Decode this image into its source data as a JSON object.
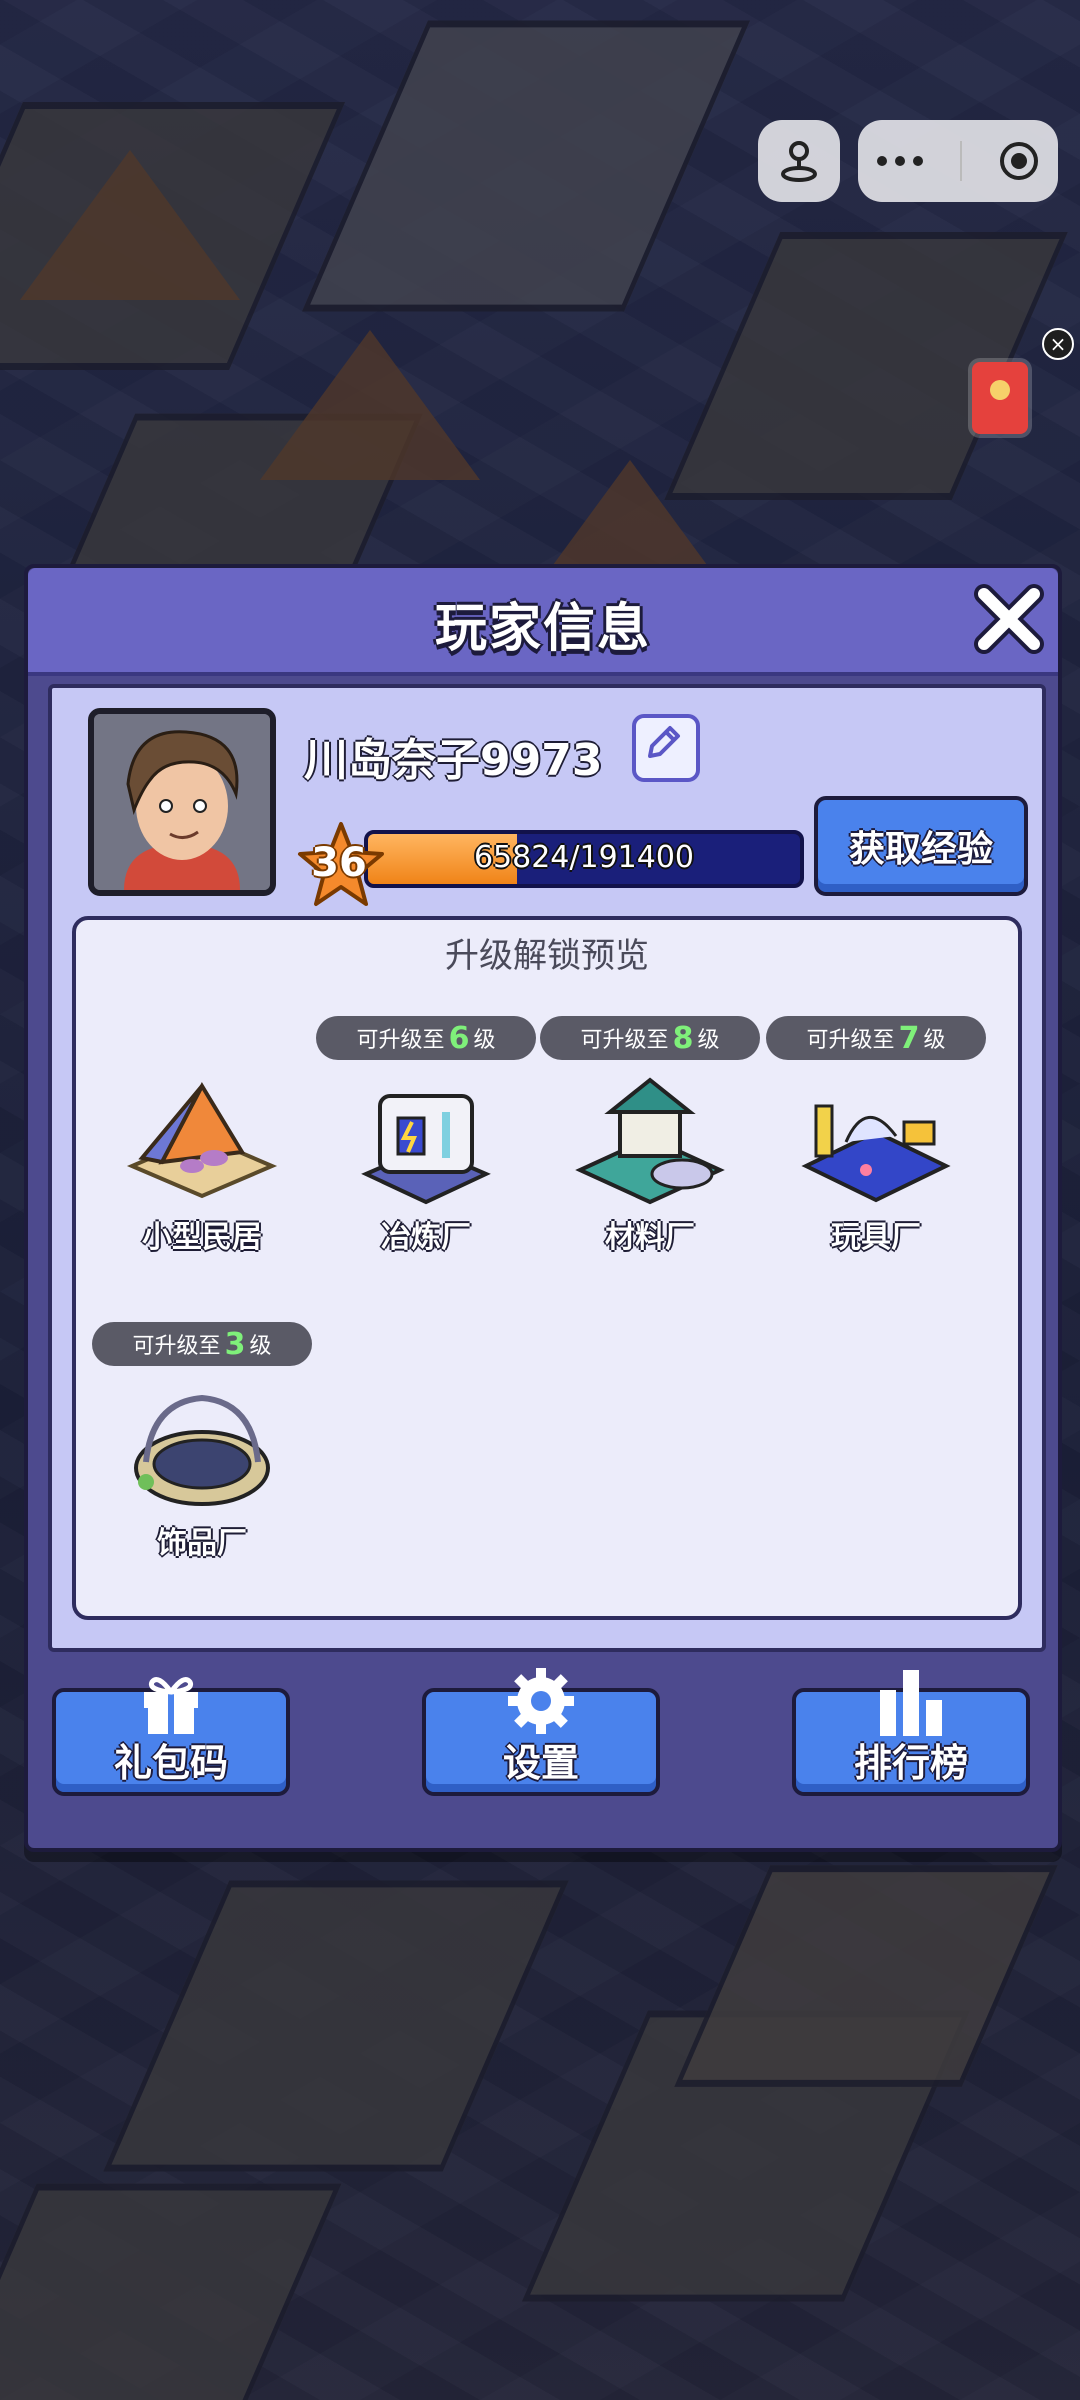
{
  "dialog": {
    "title": "玩家信息"
  },
  "player": {
    "name": "川岛奈子9973",
    "level": "36",
    "exp_current": 65824,
    "exp_max": 191400,
    "exp_text": "65824/191400",
    "get_exp_label": "获取经验"
  },
  "preview": {
    "title": "升级解锁预览",
    "buildings": [
      {
        "name": "小型民居",
        "pill_prefix": "",
        "pill_level": "",
        "pill_suffix": ""
      },
      {
        "name": "冶炼厂",
        "pill_prefix": "可升级至",
        "pill_level": "6",
        "pill_suffix": "级"
      },
      {
        "name": "材料厂",
        "pill_prefix": "可升级至",
        "pill_level": "8",
        "pill_suffix": "级"
      },
      {
        "name": "玩具厂",
        "pill_prefix": "可升级至",
        "pill_level": "7",
        "pill_suffix": "级"
      },
      {
        "name": "饰品厂",
        "pill_prefix": "可升级至",
        "pill_level": "3",
        "pill_suffix": "级"
      }
    ]
  },
  "footer": {
    "gift_label": "礼包码",
    "settings_label": "设置",
    "rank_label": "排行榜"
  },
  "colors": {
    "dialog_bg": "#4d4a8e",
    "header_bg": "#6a66c4",
    "button_blue": "#4a82ec",
    "exp_fill": "#f08418",
    "level_green": "#7ff07a"
  }
}
